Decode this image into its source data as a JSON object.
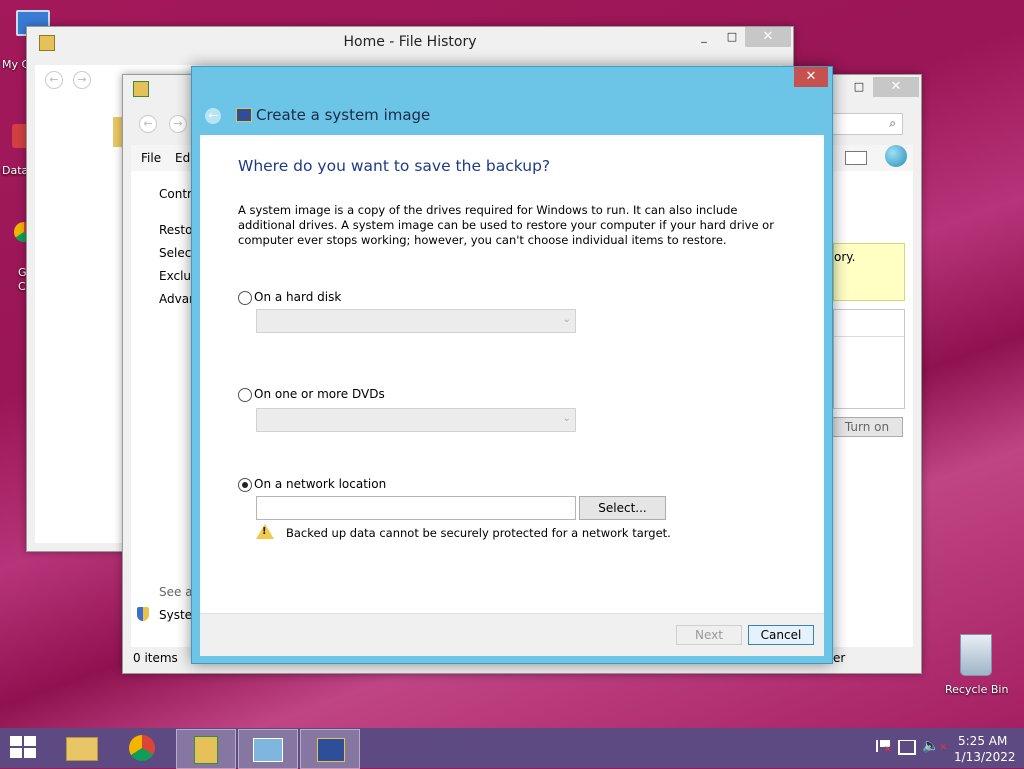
{
  "desktop": {
    "icons": [
      {
        "label": "My C",
        "icon": "computer-icon"
      },
      {
        "label": "Data",
        "icon": "database-shortcut-icon"
      },
      {
        "label": "G\nC",
        "icon": "chrome-shortcut-icon"
      },
      {
        "label": "Recycle Bin",
        "icon": "recycle-bin-icon"
      }
    ]
  },
  "window_file_history": {
    "title": "Home - File History"
  },
  "window_backup": {
    "menu": [
      "File",
      "Edi"
    ],
    "sidebar": [
      "Contro",
      "Restor",
      "Select",
      "Exclud",
      "Advan"
    ],
    "see_also": "See als",
    "system_link": "Syster",
    "status": "0 items",
    "status_right": "er",
    "notice_fragment": "ory.",
    "turn_on": "Turn on"
  },
  "dialog": {
    "title": "Create a system image",
    "heading": "Where do you want to save the backup?",
    "description": "A system image is a copy of the drives required for Windows to run. It can also include additional drives. A system image can be used to restore your computer if your hard drive or computer ever stops working; however, you can't choose individual items to restore.",
    "options": [
      {
        "label": "On a hard disk",
        "checked": false
      },
      {
        "label": "On one or more DVDs",
        "checked": false
      },
      {
        "label": "On a network location",
        "checked": true
      }
    ],
    "network_path": "",
    "select_button": "Select...",
    "warning": "Backed up data cannot be securely protected for a network target.",
    "next_button": "Next",
    "cancel_button": "Cancel"
  },
  "taskbar": {
    "time": "5:25 AM",
    "date": "1/13/2022"
  },
  "colors": {
    "accent": "#6cc5e6",
    "heading": "#1e3b8a",
    "taskbar": "#5d4a82"
  }
}
